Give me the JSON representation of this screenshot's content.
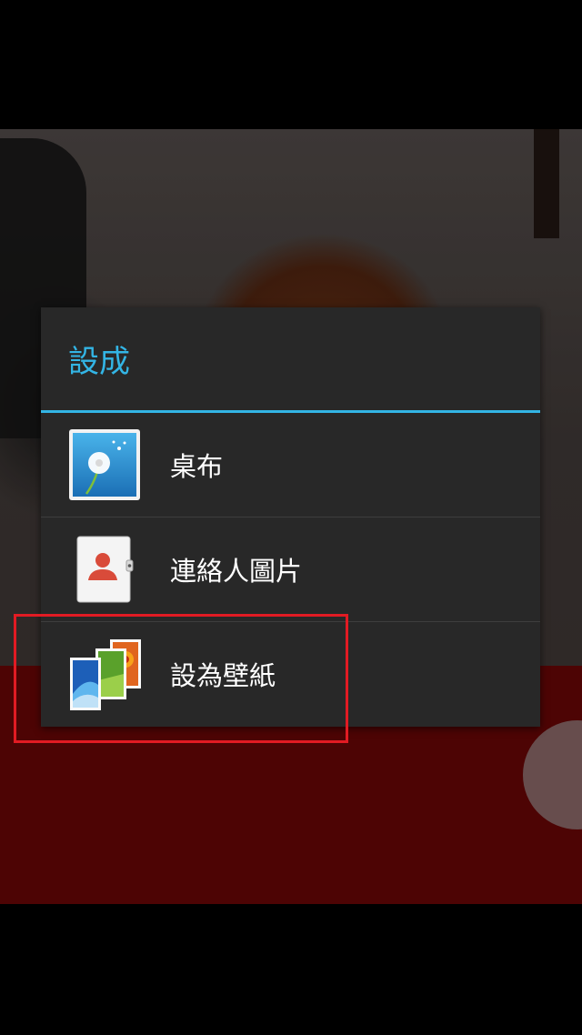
{
  "dialog": {
    "title": "設成",
    "options": [
      {
        "label": "桌布",
        "icon": "dandelion-wallpaper-icon"
      },
      {
        "label": "連絡人圖片",
        "icon": "contact-photo-icon"
      },
      {
        "label": "設為壁紙",
        "icon": "wallpaper-gallery-icon"
      }
    ]
  },
  "colors": {
    "accent": "#33b5e5",
    "dialog_background": "#282828",
    "highlight_box": "#e21b23"
  }
}
